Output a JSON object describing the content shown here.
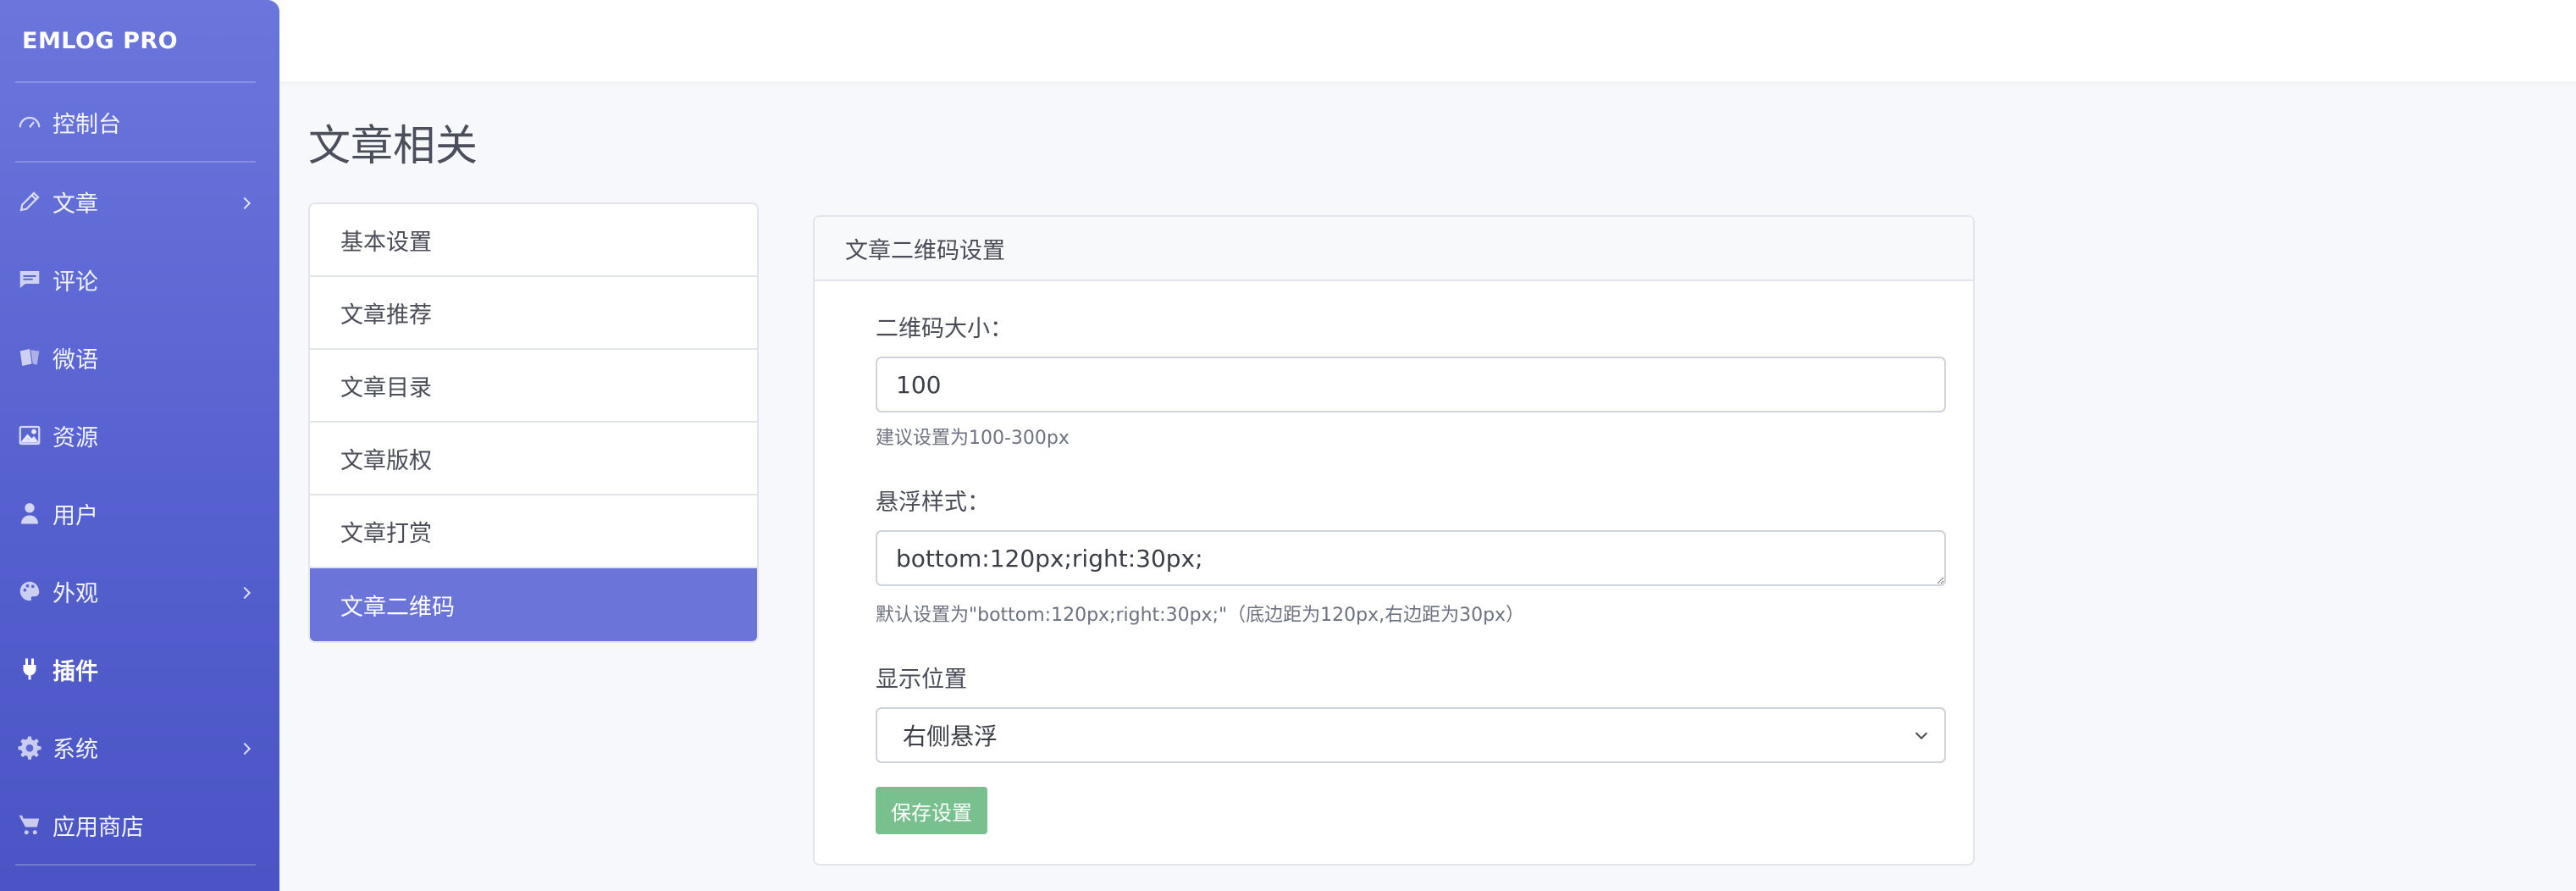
{
  "sidebar": {
    "brand": "EMLOG PRO",
    "items": [
      {
        "label": "控制台",
        "icon": "dashboard-icon",
        "has_children": false
      },
      {
        "label": "文章",
        "icon": "pencil-icon",
        "has_children": true
      },
      {
        "label": "评论",
        "icon": "comment-icon",
        "has_children": false
      },
      {
        "label": "微语",
        "icon": "notes-icon",
        "has_children": false
      },
      {
        "label": "资源",
        "icon": "image-icon",
        "has_children": false
      },
      {
        "label": "用户",
        "icon": "user-icon",
        "has_children": false
      },
      {
        "label": "外观",
        "icon": "palette-icon",
        "has_children": true
      },
      {
        "label": "插件",
        "icon": "plug-icon",
        "has_children": false,
        "active": true
      },
      {
        "label": "系统",
        "icon": "gear-icon",
        "has_children": true
      },
      {
        "label": "应用商店",
        "icon": "cart-icon",
        "has_children": false
      }
    ]
  },
  "page": {
    "title": "文章相关"
  },
  "subnav": {
    "items": [
      {
        "label": "基本设置"
      },
      {
        "label": "文章推荐"
      },
      {
        "label": "文章目录"
      },
      {
        "label": "文章版权"
      },
      {
        "label": "文章打赏"
      },
      {
        "label": "文章二维码",
        "active": true
      }
    ]
  },
  "form": {
    "header": "文章二维码设置",
    "qr_size": {
      "label": "二维码大小：",
      "value": "100",
      "hint": "建议设置为100-300px"
    },
    "float_style": {
      "label": "悬浮样式：",
      "value": "bottom:120px;right:30px;",
      "hint": "默认设置为\"bottom:120px;right:30px;\"（底边距为120px,右边距为30px）"
    },
    "position": {
      "label": "显示位置",
      "selected": "右侧悬浮"
    },
    "save_label": "保存设置"
  },
  "colors": {
    "sidebar": "#5d67d4",
    "active_subnav": "#6b74d9",
    "save_button": "#78c08e"
  }
}
